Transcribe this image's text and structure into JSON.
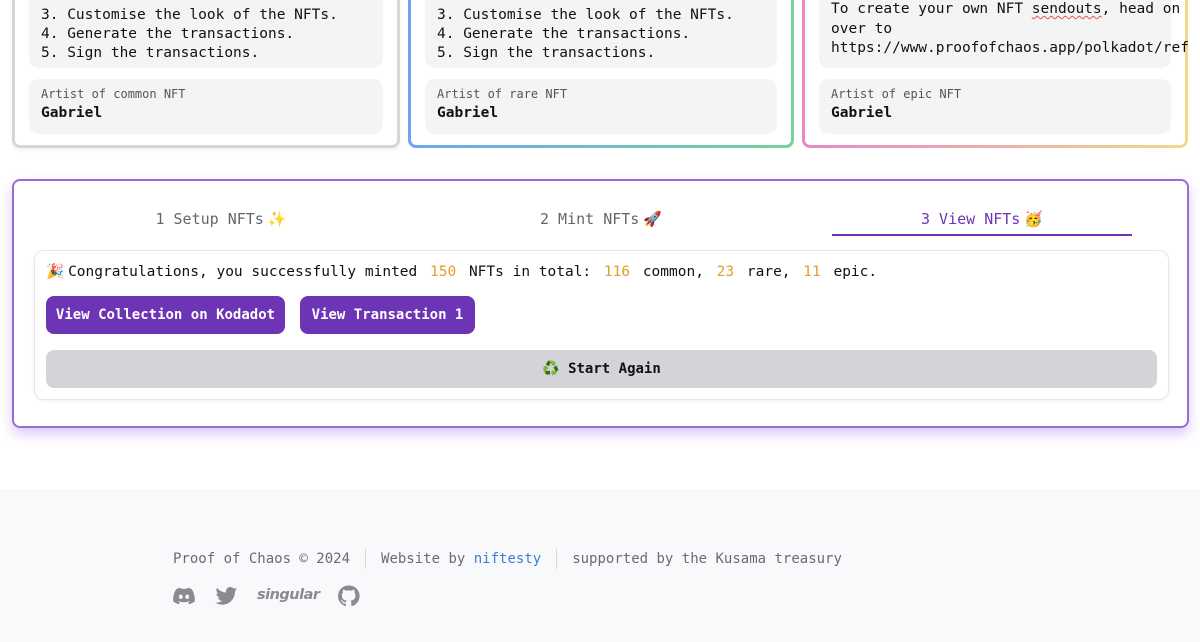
{
  "cards": [
    {
      "steps": [
        "3. Customise the look of the NFTs.",
        "4. Generate the transactions.",
        "5. Sign the transactions."
      ],
      "artist_label": "Artist of common NFT",
      "artist_name": "Gabriel"
    },
    {
      "steps": [
        "3. Customise the look of the NFTs.",
        "4. Generate the transactions.",
        "5. Sign the transactions."
      ],
      "artist_label": "Artist of rare NFT",
      "artist_name": "Gabriel"
    },
    {
      "info_prefix": "To create your own NFT ",
      "info_squiggle": "sendouts",
      "info_suffix": ", head on",
      "info_line2": "over to",
      "info_url": "https://www.proofofchaos.app/polkadot/ref",
      "artist_label": "Artist of epic NFT",
      "artist_name": "Gabriel"
    }
  ],
  "tabs": [
    {
      "label": "1 Setup NFTs",
      "emoji": "✨"
    },
    {
      "label": "2 Mint NFTs",
      "emoji": "🚀"
    },
    {
      "label": "3 View NFTs",
      "emoji": "🥳"
    }
  ],
  "result": {
    "emoji": "🎉",
    "text_1": "Congratulations, you successfully minted",
    "total": "150",
    "text_2": "NFTs in total:",
    "common": "116",
    "common_label": "common,",
    "rare": "23",
    "rare_label": "rare,",
    "epic": "11",
    "epic_label": "epic."
  },
  "buttons": {
    "kodadot": "View Collection on Kodadot",
    "transaction": "View Transaction 1",
    "start_again": "♻️ Start Again"
  },
  "footer": {
    "copyright": "Proof of Chaos © 2024",
    "website_by": "Website by",
    "website_link": "niftesty",
    "supported": "supported by the Kusama treasury",
    "singular": "singular"
  },
  "colors": {
    "accent_purple": "#6d35b6",
    "number_orange": "#e29d2d",
    "link_blue": "#3b7fd8"
  },
  "icons": [
    "discord-icon",
    "twitter-icon",
    "singular-logo",
    "github-icon"
  ]
}
